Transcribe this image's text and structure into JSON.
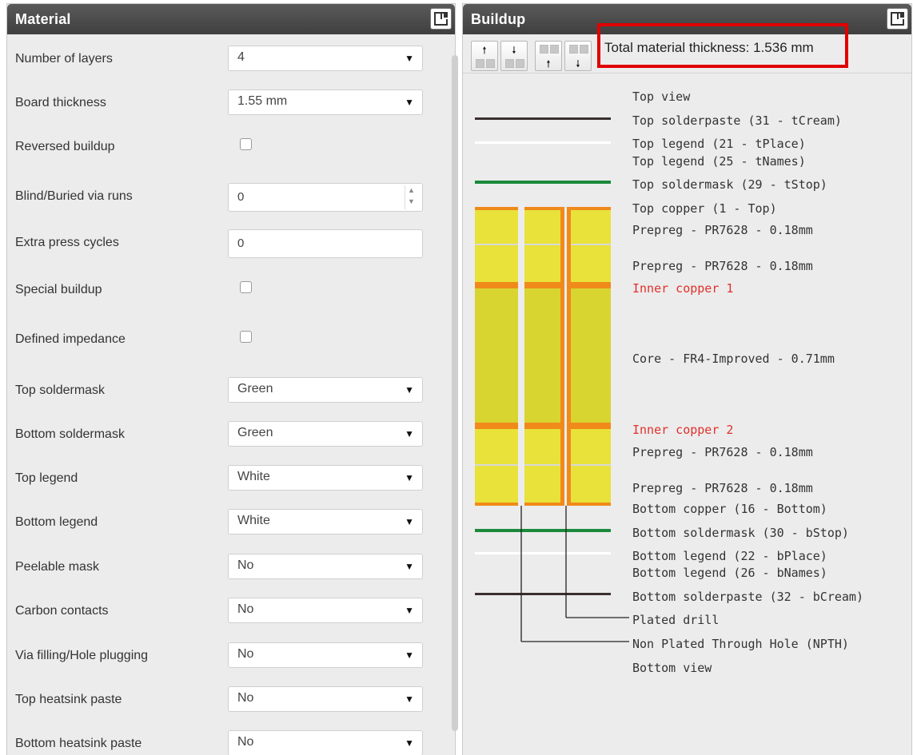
{
  "material": {
    "title": "Material",
    "fields": [
      {
        "label": "Number of layers",
        "type": "select",
        "value": "4"
      },
      {
        "label": "Board thickness",
        "type": "select",
        "value": "1.55 mm"
      },
      {
        "label": "Reversed buildup",
        "type": "checkbox",
        "checked": false
      },
      {
        "label": "Blind/Buried via runs",
        "type": "spinner",
        "value": "0"
      },
      {
        "label": "Extra press cycles",
        "type": "text",
        "value": "0"
      },
      {
        "label": "Special buildup",
        "type": "checkbox",
        "checked": false
      },
      {
        "label": "Defined impedance",
        "type": "checkbox",
        "checked": false
      },
      {
        "label": "Top soldermask",
        "type": "select",
        "value": "Green"
      },
      {
        "label": "Bottom soldermask",
        "type": "select",
        "value": "Green"
      },
      {
        "label": "Top legend",
        "type": "select",
        "value": "White"
      },
      {
        "label": "Bottom legend",
        "type": "select",
        "value": "White"
      },
      {
        "label": "Peelable mask",
        "type": "select",
        "value": "No"
      },
      {
        "label": "Carbon contacts",
        "type": "select",
        "value": "No"
      },
      {
        "label": "Via filling/Hole plugging",
        "type": "select",
        "value": "No"
      },
      {
        "label": "Top heatsink paste",
        "type": "select",
        "value": "No"
      },
      {
        "label": "Bottom heatsink paste",
        "type": "select",
        "value": "No"
      }
    ]
  },
  "buildup": {
    "title": "Buildup",
    "total_thickness": "Total material thickness: 1.536 mm",
    "colors": {
      "solderpaste": "#3a2e2e",
      "legend": "#ffffff",
      "soldermask": "#1a8a3a",
      "copper": "#f08a1a",
      "prepreg": "#e8e23a",
      "core": "#d8d430",
      "drill_line": "#222222",
      "inner_copper_text": "#e0302b"
    },
    "layers": [
      {
        "name": "top-view",
        "text": "Top view",
        "color": "normal"
      },
      {
        "name": "top-solderpaste",
        "text": "Top solderpaste (31 - tCream)",
        "color": "normal"
      },
      {
        "name": "top-legend-21",
        "text": "Top legend (21 - tPlace)",
        "color": "normal"
      },
      {
        "name": "top-legend-25",
        "text": "Top legend (25 - tNames)",
        "color": "normal"
      },
      {
        "name": "top-soldermask",
        "text": "Top soldermask (29 - tStop)",
        "color": "normal"
      },
      {
        "name": "top-copper",
        "text": "Top copper (1 - Top)",
        "color": "normal"
      },
      {
        "name": "prepreg-1",
        "text": "Prepreg - PR7628 - 0.18mm",
        "color": "normal"
      },
      {
        "name": "prepreg-2",
        "text": "Prepreg - PR7628 - 0.18mm",
        "color": "normal"
      },
      {
        "name": "inner-copper-1",
        "text": "Inner copper 1",
        "color": "red"
      },
      {
        "name": "core",
        "text": "Core - FR4-Improved - 0.71mm",
        "color": "normal"
      },
      {
        "name": "inner-copper-2",
        "text": "Inner copper 2",
        "color": "red"
      },
      {
        "name": "prepreg-3",
        "text": "Prepreg - PR7628 - 0.18mm",
        "color": "normal"
      },
      {
        "name": "prepreg-4",
        "text": "Prepreg - PR7628 - 0.18mm",
        "color": "normal"
      },
      {
        "name": "bottom-copper",
        "text": "Bottom copper (16 - Bottom)",
        "color": "normal"
      },
      {
        "name": "bottom-soldermask",
        "text": "Bottom soldermask (30 - bStop)",
        "color": "normal"
      },
      {
        "name": "bottom-legend-22",
        "text": "Bottom legend (22 - bPlace)",
        "color": "normal"
      },
      {
        "name": "bottom-legend-26",
        "text": "Bottom legend (26 - bNames)",
        "color": "normal"
      },
      {
        "name": "bottom-solderpaste",
        "text": "Bottom solderpaste (32 - bCream)",
        "color": "normal"
      },
      {
        "name": "plated-drill",
        "text": "Plated drill",
        "color": "normal"
      },
      {
        "name": "npth",
        "text": "Non Plated Through Hole (NPTH)",
        "color": "normal"
      },
      {
        "name": "bottom-view",
        "text": "Bottom view",
        "color": "normal"
      }
    ],
    "toolbar": [
      {
        "name": "move-layer-up",
        "icon": "arrow-up-icon"
      },
      {
        "name": "move-layer-down",
        "icon": "arrow-down-icon"
      },
      {
        "name": "add-layer-above",
        "icon": "arrow-up-icon"
      },
      {
        "name": "add-layer-below",
        "icon": "arrow-down-icon"
      }
    ]
  }
}
